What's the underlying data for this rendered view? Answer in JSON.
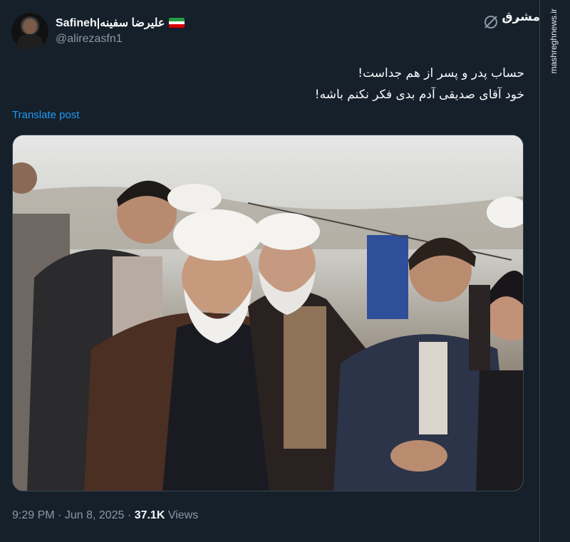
{
  "tweet": {
    "display_name": "Safineh|علیرضا سفینه",
    "handle": "@alirezasfn1",
    "text_line1": "حساب پدر و پسر از هم جداست!",
    "text_line2": "خود آقای صدیقی آدم بدی فکر نکنم باشه!",
    "translate_label": "Translate post",
    "time": "9:29 PM",
    "date": "Jun 8, 2025",
    "views_count": "37.1K",
    "views_label": "Views",
    "separator": "·"
  },
  "watermark": {
    "logo_text": "مشرق",
    "url": "mashreghnews.ir"
  },
  "icons": {
    "grok": "grok-icon",
    "more": "more-icon",
    "flag": "iran-flag-icon"
  },
  "colors": {
    "background": "#15202b",
    "link": "#1d9bf0",
    "secondary_text": "#8b98a5",
    "primary_text": "#f7f9f9"
  }
}
